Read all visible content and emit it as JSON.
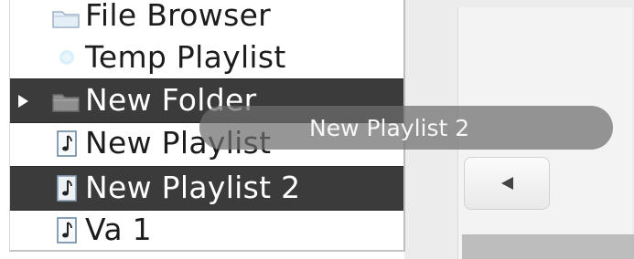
{
  "sidebar": {
    "items": [
      {
        "label": "File Browser",
        "icon": "folder-icon",
        "selected": false
      },
      {
        "label": "Temp Playlist",
        "icon": "temp-playlist-icon",
        "selected": false
      },
      {
        "label": "New Folder",
        "icon": "folder-icon",
        "selected": true,
        "expandable": true
      },
      {
        "label": "New Playlist",
        "icon": "playlist-note-icon",
        "selected": false
      },
      {
        "label": "New Playlist 2",
        "icon": "playlist-note-icon",
        "selected": true
      },
      {
        "label": "Va 1",
        "icon": "playlist-note-icon",
        "selected": false
      }
    ]
  },
  "drag": {
    "label": "New Playlist 2"
  },
  "right_panel": {
    "back_icon": "back-arrow-icon"
  },
  "colors": {
    "selection": "#3b3b3b",
    "drag_ghost": "#6e6e6e"
  }
}
